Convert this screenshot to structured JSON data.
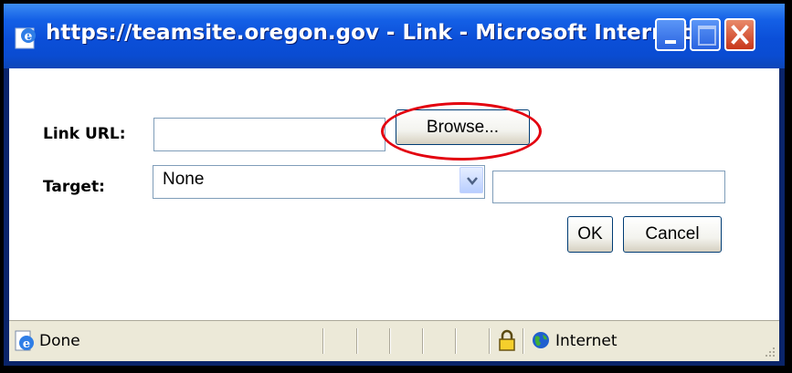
{
  "window": {
    "title": "https://teamsite.oregon.gov - Link - Microsoft Internet ...",
    "icons": {
      "app": "internet-explorer-icon",
      "minimize": "minimize-icon",
      "maximize": "maximize-icon",
      "close": "close-icon"
    }
  },
  "form": {
    "link_url": {
      "label": "Link URL:",
      "value": "",
      "browse_label": "Browse..."
    },
    "target": {
      "label": "Target:",
      "selected": "None",
      "custom_value": ""
    },
    "ok_label": "OK",
    "cancel_label": "Cancel"
  },
  "status_bar": {
    "status_text": "Done",
    "zone_text": "Internet",
    "icons": [
      "page-done-icon",
      "lock-icon",
      "globe-icon",
      "resize-grip-icon"
    ]
  },
  "colors": {
    "title_bar": "#0b4fd8",
    "highlight_circle": "#e3000f",
    "status_bar": "#ece9d8"
  }
}
